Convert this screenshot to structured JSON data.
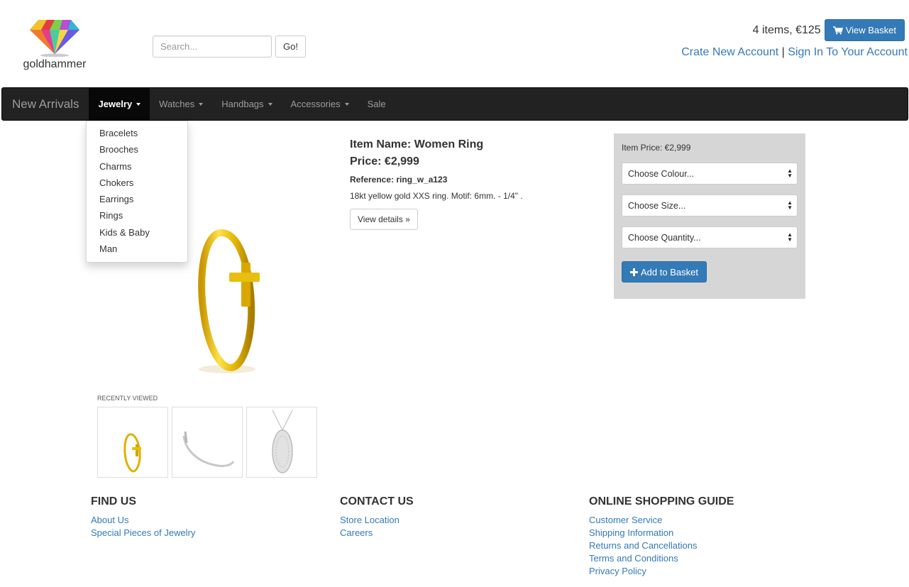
{
  "brand": {
    "name": "goldhammer"
  },
  "search": {
    "placeholder": "Search...",
    "button": "Go!"
  },
  "basket": {
    "summary": "4 items, €125",
    "button": "View Basket"
  },
  "account": {
    "create": "Crate New Account",
    "separator": "|",
    "signin": "Sign In To Your Account"
  },
  "nav": {
    "brand": "New Arrivals",
    "items": [
      "Jewelry",
      "Watches",
      "Handbags",
      "Accessories",
      "Sale"
    ]
  },
  "dropdown": {
    "items": [
      "Bracelets",
      "Brooches",
      "Charms",
      "Chokers",
      "Earrings",
      "Rings",
      "Kids & Baby",
      "Man"
    ]
  },
  "product": {
    "name": "Item Name: Women Ring",
    "price": "Price: €2,999",
    "reference": "Reference: ring_w_a123",
    "description": "18kt yellow gold XXS ring. Motif: 6mm. - 1/4\" .",
    "details_button": "View details »"
  },
  "panel": {
    "item_price": "Item Price: €2,999",
    "colour": "Choose Colour...",
    "size": "Choose Size...",
    "quantity": "Choose Quantity...",
    "add_button": "Add to Basket"
  },
  "recent": {
    "label": "Recently viewed"
  },
  "footer": {
    "find": {
      "title": "FIND US",
      "links": [
        "About Us",
        "Special Pieces of Jewelry"
      ]
    },
    "contact": {
      "title": "CONTACT US",
      "links": [
        "Store Location",
        "Careers"
      ]
    },
    "guide": {
      "title": "ONLINE SHOPPING GUIDE",
      "links": [
        "Customer Service",
        "Shipping Information",
        "Returns and Cancellations",
        "Terms and Conditions",
        "Privacy Policy"
      ]
    }
  },
  "colors": {
    "accent": "#337ab7",
    "navbar": "#222222",
    "gold": "#e6b800",
    "panel": "#d6d6d6"
  }
}
